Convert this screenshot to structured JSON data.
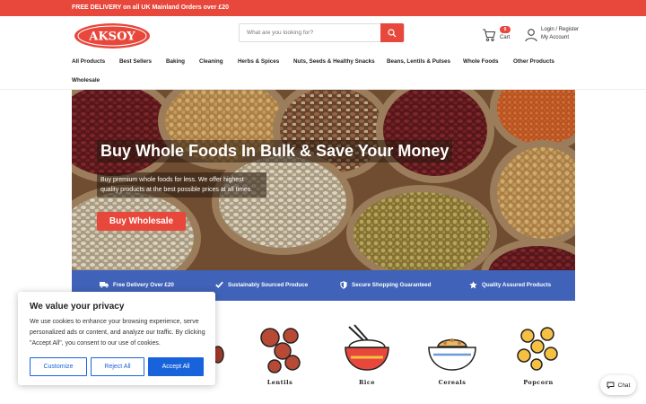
{
  "topbar": {
    "text": "FREE DELIVERY on all UK Mainland Orders over £20"
  },
  "brand": {
    "logo_text": "AKSOY",
    "accent": "#e8473c"
  },
  "search": {
    "placeholder": "What are you looking for?",
    "value": "",
    "icon": "search-icon"
  },
  "cart": {
    "count": "0",
    "label": "Cart",
    "icon": "cart-icon"
  },
  "account": {
    "line1": "Login / Register",
    "line2": "My Account",
    "icon": "user-icon"
  },
  "nav": {
    "items": [
      {
        "label": "All Products"
      },
      {
        "label": "Best Sellers"
      },
      {
        "label": "Baking"
      },
      {
        "label": "Cleaning"
      },
      {
        "label": "Herbs & Spices"
      },
      {
        "label": "Nuts, Seeds & Healthy Snacks"
      },
      {
        "label": "Beans, Lentils & Pulses"
      },
      {
        "label": "Whole Foods"
      },
      {
        "label": "Other Products"
      },
      {
        "label": "Wholesale"
      }
    ]
  },
  "hero": {
    "title": "Buy Whole Foods In Bulk & Save Your Money",
    "subtitle": "Buy premium whole foods for less. We offer highest quality products at the best possible prices at all times.",
    "cta": "Buy Wholesale"
  },
  "features": {
    "color": "#4062b8",
    "items": [
      {
        "label": "Free Delivery Over £20",
        "icon": "truck-icon"
      },
      {
        "label": "Sustainably Sourced Produce",
        "icon": "check-icon"
      },
      {
        "label": "Secure Shopping Guaranteed",
        "icon": "shield-icon"
      },
      {
        "label": "Quality Assured Products",
        "icon": "star-icon"
      }
    ]
  },
  "categories": [
    {
      "label": "Lentils",
      "icon": "lentils-icon"
    },
    {
      "label": "Rice",
      "icon": "rice-bowl-icon"
    },
    {
      "label": "Cereals",
      "icon": "cereal-bowl-icon"
    },
    {
      "label": "Popcorn",
      "icon": "popcorn-icon"
    }
  ],
  "cookie": {
    "title": "We value your privacy",
    "text": "We use cookies to enhance your browsing experience, serve personalized ads or content, and analyze our traffic. By clicking \"Accept All\", you consent to our use of cookies.",
    "customize": "Customize",
    "reject": "Reject All",
    "accept": "Accept All",
    "button_color": "#1863dc"
  },
  "chat": {
    "label": "Chat",
    "icon": "chat-icon"
  }
}
